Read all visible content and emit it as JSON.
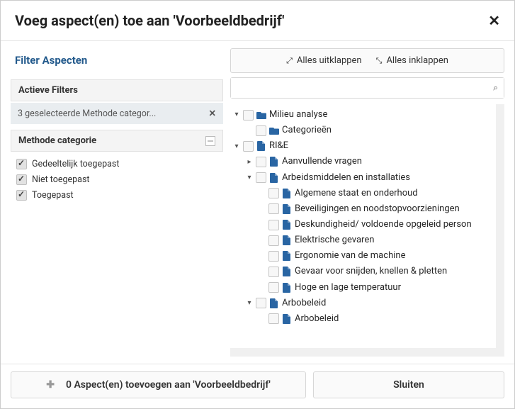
{
  "modal": {
    "title": "Voeg aspect(en) toe aan 'Voorbeeldbedrijf'"
  },
  "filter": {
    "heading": "Filter Aspecten",
    "active_heading": "Actieve Filters",
    "active_chip": "3 geselecteerde Methode categor...",
    "category_heading": "Methode categorie",
    "options": {
      "0": "Gedeeltelijk toegepast",
      "1": "Niet toegepast",
      "2": "Toegepast"
    }
  },
  "toolbar": {
    "expand": "Alles uitklappen",
    "collapse": "Alles inklappen"
  },
  "search": {
    "placeholder": ""
  },
  "tree": {
    "n0": "Milieu analyse",
    "n0_0": "Categorieën",
    "n1": "RI&E",
    "n1_0": "Aanvullende vragen",
    "n1_1": "Arbeidsmiddelen en installaties",
    "n1_1_0": "Algemene staat en onderhoud",
    "n1_1_1": "Beveiligingen en noodstopvoorzieningen",
    "n1_1_2": "Deskundigheid/ voldoende opgeleid person",
    "n1_1_3": "Elektrische gevaren",
    "n1_1_4": "Ergonomie van de machine",
    "n1_1_5": "Gevaar voor snijden, knellen & pletten",
    "n1_1_6": "Hoge en lage temperatuur",
    "n1_2": "Arbobeleid",
    "n1_2_0": "Arbobeleid"
  },
  "footer": {
    "add": "0 Aspect(en) toevoegen aan 'Voorbeeldbedrijf'",
    "close": "Sluiten"
  },
  "icons": {
    "expand": "↗",
    "expand2": "↙",
    "collapse": "↘",
    "collapse2": "↖"
  }
}
